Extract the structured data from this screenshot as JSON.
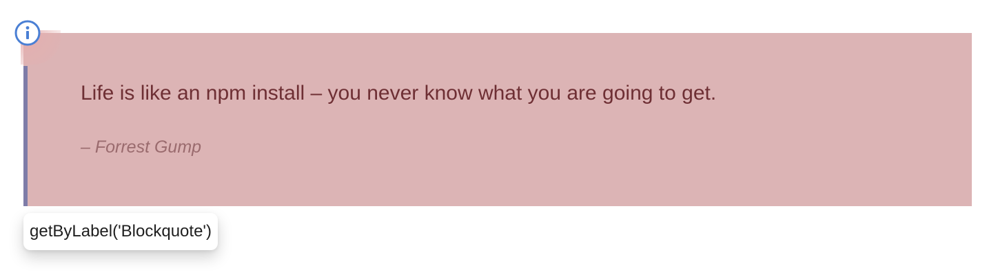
{
  "blockquote": {
    "quote": "Life is like an npm install – you never know what you are going to get.",
    "citation": "– Forrest Gump"
  },
  "locator": {
    "text": "getByLabel('Blockquote')"
  },
  "icons": {
    "info": "info-icon"
  },
  "colors": {
    "highlight": "#dcb4b5",
    "accent_bar": "#7e7ca8",
    "quote_text": "#6e2f34",
    "citation_text": "#9a6b6e",
    "info_icon": "#4a7fd4"
  }
}
